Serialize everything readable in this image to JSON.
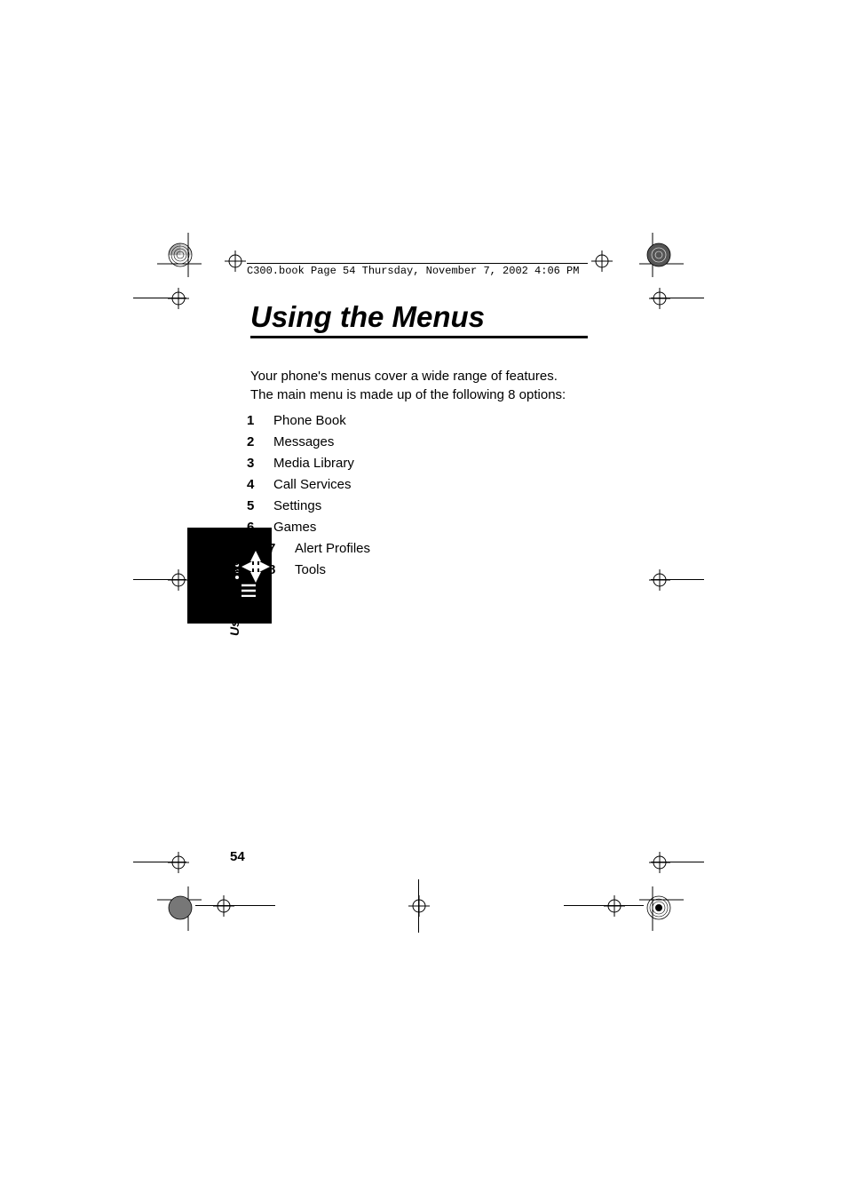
{
  "header": {
    "text": "C300.book  Page 54  Thursday, November 7, 2002  4:06 PM"
  },
  "title": "Using the Menus",
  "intro": "Your phone's menus cover a wide range of features. The main menu is made up of the following 8 options:",
  "list": [
    {
      "num": "1",
      "label": "Phone Book",
      "indented": false
    },
    {
      "num": "2",
      "label": "Messages",
      "indented": false
    },
    {
      "num": "3",
      "label": "Media Library",
      "indented": false
    },
    {
      "num": "4",
      "label": "Call Services",
      "indented": false
    },
    {
      "num": "5",
      "label": "Settings",
      "indented": false
    },
    {
      "num": "6",
      "label": "Games",
      "indented": false
    },
    {
      "num": "7",
      "label": "Alert Profiles",
      "indented": true
    },
    {
      "num": "8",
      "label": "Tools",
      "indented": true
    }
  ],
  "side_label": "Using the Menus",
  "page_number": "54"
}
